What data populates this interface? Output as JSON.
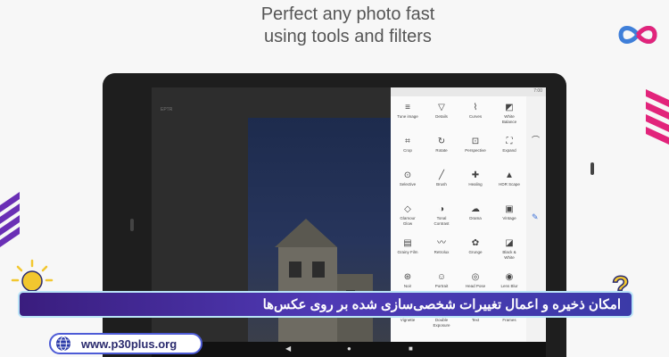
{
  "headline": {
    "line1": "Perfect any photo fast",
    "line2": "using tools and filters"
  },
  "status": {
    "time": "7:00"
  },
  "photo_label": "EPTR",
  "tools": [
    {
      "label": "Tune image",
      "icon": "≡"
    },
    {
      "label": "Details",
      "icon": "▽"
    },
    {
      "label": "Curves",
      "icon": "⌇"
    },
    {
      "label": "White\nBalance",
      "icon": "◩"
    },
    {
      "label": "Crop",
      "icon": "⌗"
    },
    {
      "label": "Rotate",
      "icon": "↻"
    },
    {
      "label": "Perspective",
      "icon": "⊡"
    },
    {
      "label": "Expand",
      "icon": "⛶"
    },
    {
      "label": "Selective",
      "icon": "⊙"
    },
    {
      "label": "Brush",
      "icon": "╱"
    },
    {
      "label": "Healing",
      "icon": "✚"
    },
    {
      "label": "HDR Scape",
      "icon": "▲"
    },
    {
      "label": "Glamour\nGlow",
      "icon": "◇"
    },
    {
      "label": "Tonal\nContrast",
      "icon": "◑"
    },
    {
      "label": "Drama",
      "icon": "☁"
    },
    {
      "label": "Vintage",
      "icon": "▣"
    },
    {
      "label": "Grainy Film",
      "icon": "▤"
    },
    {
      "label": "Retrolux",
      "icon": "〰"
    },
    {
      "label": "Grunge",
      "icon": "✿"
    },
    {
      "label": "Black &\nWhite",
      "icon": "◪"
    },
    {
      "label": "Noir",
      "icon": "⊛"
    },
    {
      "label": "Portrait",
      "icon": "☺"
    },
    {
      "label": "Head Pose",
      "icon": "◎"
    },
    {
      "label": "Lens Blur",
      "icon": "◉"
    },
    {
      "label": "Vignette",
      "icon": "▢"
    },
    {
      "label": "Double\nExposure",
      "icon": "◍"
    },
    {
      "label": "Text",
      "icon": "Tт"
    },
    {
      "label": "Frames",
      "icon": "▭"
    }
  ],
  "banner": {
    "text": "امکان ذخیره و اعمال تغییرات شخصی‌سازی شده بر روی عکس‌ها"
  },
  "website": {
    "url": "www.p30plus.org"
  },
  "colors": {
    "banner": "#4f3ab5",
    "accent": "#f2c72f",
    "stripe": "#7a3fc4"
  }
}
